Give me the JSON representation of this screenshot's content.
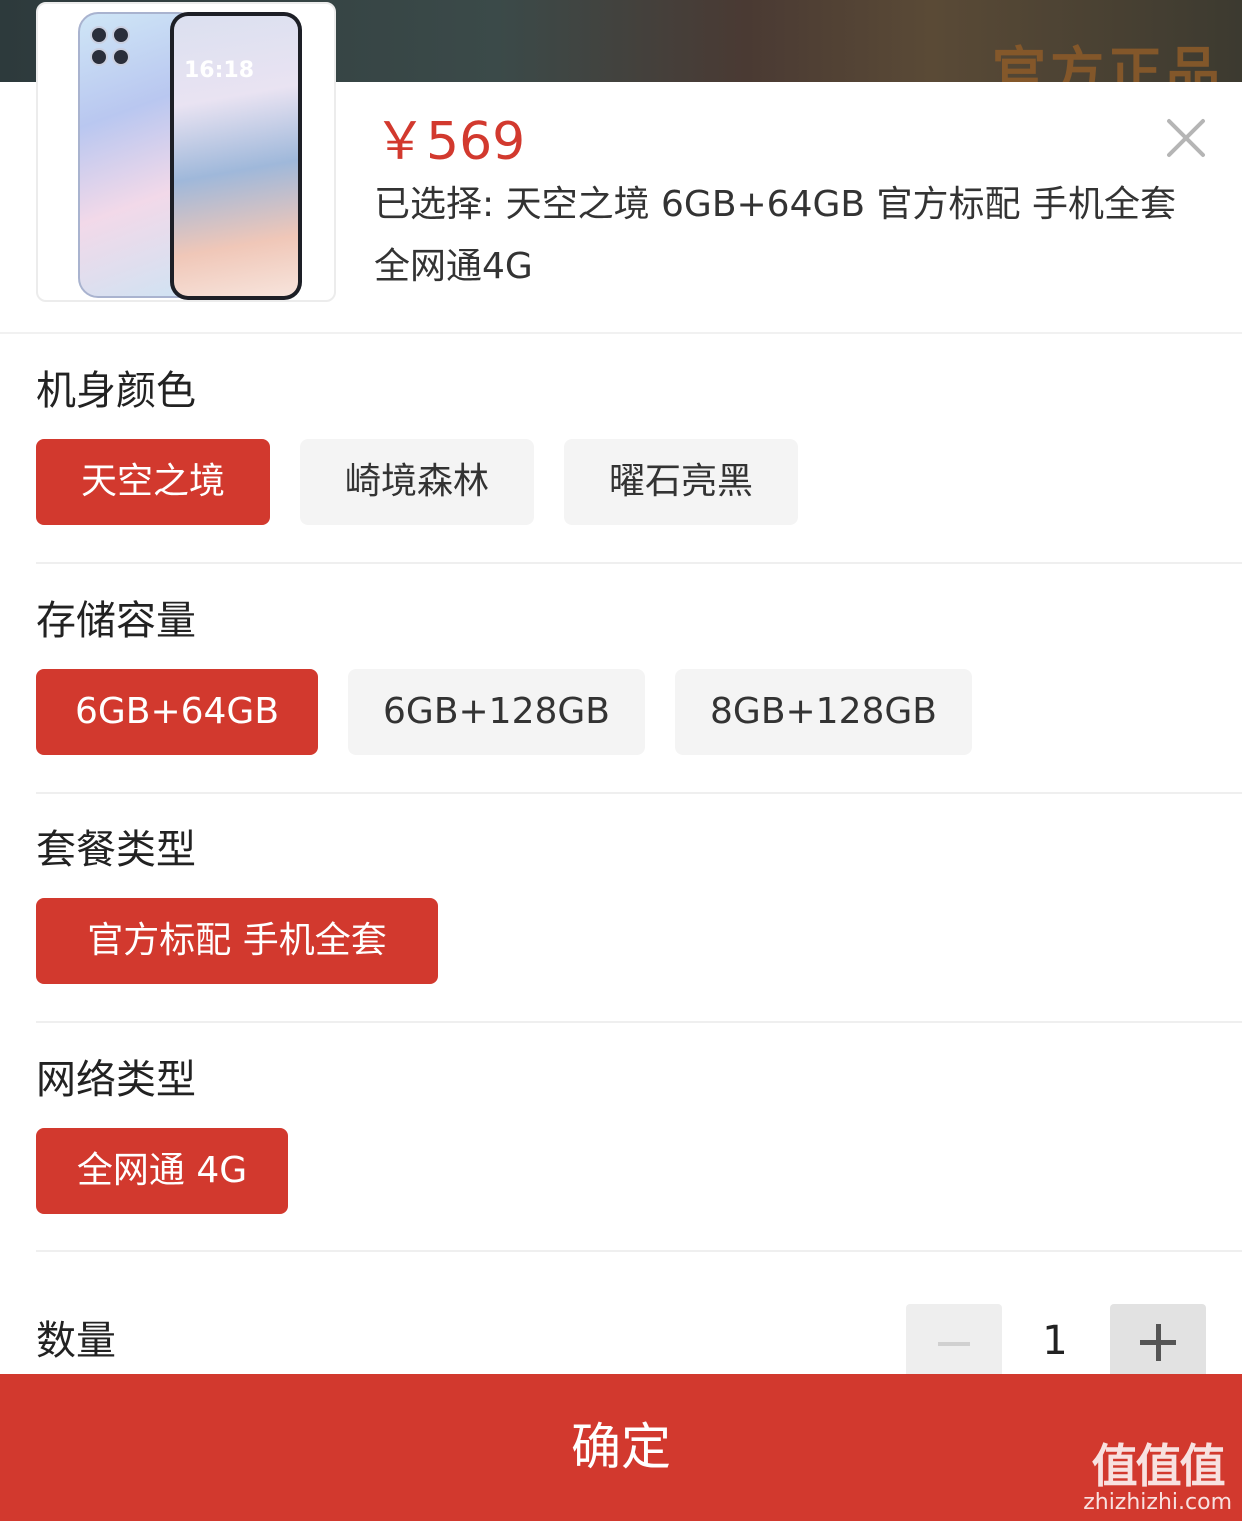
{
  "product": {
    "price": "￥569",
    "selected_text": "已选择: 天空之境 6GB+64GB 官方标配 手机全套 全网通4G",
    "phone_clock": "16:18"
  },
  "sections": {
    "color": {
      "title": "机身颜色",
      "options": [
        "天空之境",
        "崎境森林",
        "曜石亮黑"
      ],
      "selected": "天空之境"
    },
    "storage": {
      "title": "存储容量",
      "options": [
        "6GB+64GB",
        "6GB+128GB",
        "8GB+128GB"
      ],
      "selected": "6GB+64GB"
    },
    "package": {
      "title": "套餐类型",
      "options": [
        "官方标配 手机全套"
      ],
      "selected": "官方标配 手机全套"
    },
    "network": {
      "title": "网络类型",
      "options": [
        "全网通 4G"
      ],
      "selected": "全网通 4G"
    }
  },
  "quantity": {
    "label": "数量",
    "value": "1"
  },
  "confirm_label": "确定",
  "backdrop_text": "官方正品",
  "watermark": {
    "mark": "值值值",
    "url": "zhizhizhi.com"
  },
  "colors": {
    "accent": "#d2392e",
    "option_bg": "#f4f4f4"
  },
  "icons": {
    "close": "close-icon",
    "minus": "minus-icon",
    "plus": "plus-icon"
  }
}
